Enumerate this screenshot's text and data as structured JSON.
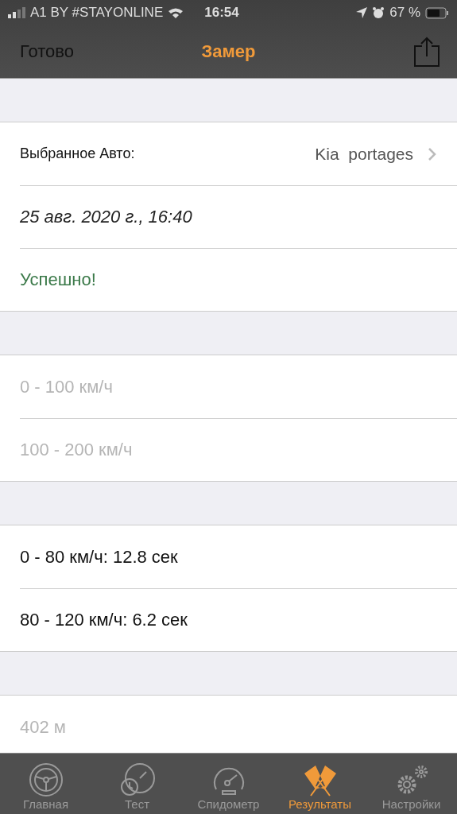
{
  "status_bar": {
    "carrier": "A1 BY #STAYONLINE",
    "time": "16:54",
    "battery": "67 %"
  },
  "nav": {
    "left": "Готово",
    "title": "Замер"
  },
  "sections": [
    {
      "rows": [
        {
          "kind": "detail",
          "label": "Выбранное Авто:",
          "value": "Kia  portages"
        },
        {
          "kind": "date",
          "label": "25 авг. 2020 г., 16:40"
        },
        {
          "kind": "success",
          "label": "Успешно!"
        }
      ]
    },
    {
      "rows": [
        {
          "kind": "plain",
          "label": "0 - 100 км/ч",
          "disabled": true
        },
        {
          "kind": "plain",
          "label": "100 - 200 км/ч",
          "disabled": true
        }
      ]
    },
    {
      "rows": [
        {
          "kind": "plain",
          "label": "0 - 80 км/ч: 12.8 сек",
          "disabled": false
        },
        {
          "kind": "plain",
          "label": "80 - 120 км/ч: 6.2 сек",
          "disabled": false
        }
      ]
    },
    {
      "rows": [
        {
          "kind": "plain",
          "label": "402 м",
          "disabled": true
        }
      ]
    }
  ],
  "tabs": [
    {
      "label": "Главная",
      "kind": "wheel",
      "selected": false
    },
    {
      "label": "Тест",
      "kind": "timer",
      "selected": false
    },
    {
      "label": "Спидометр",
      "kind": "speedometer",
      "selected": false
    },
    {
      "label": "Результаты",
      "kind": "flags",
      "selected": true
    },
    {
      "label": "Настройки",
      "kind": "gears",
      "selected": false
    }
  ]
}
